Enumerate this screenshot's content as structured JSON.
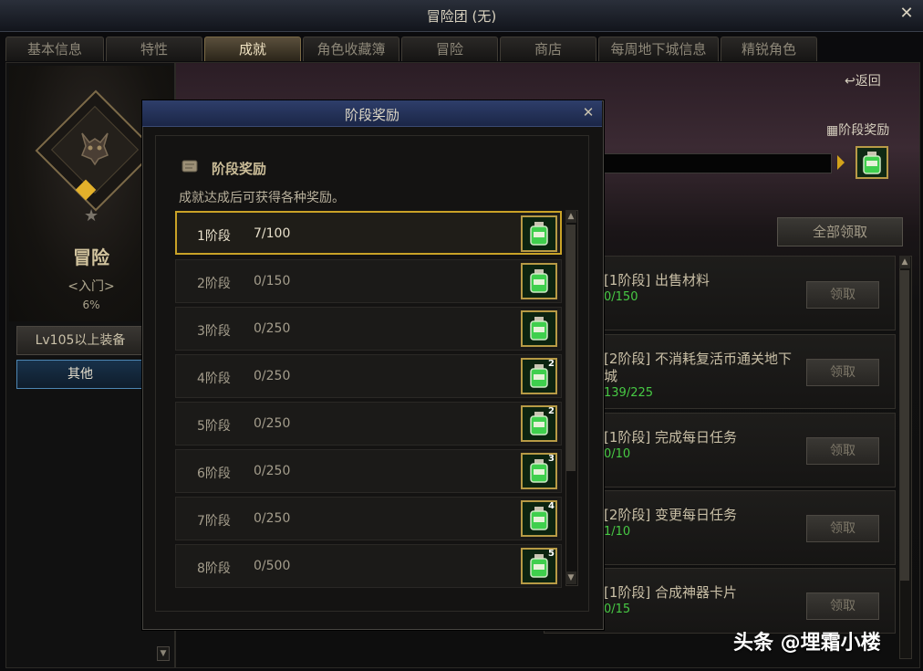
{
  "window": {
    "title": "冒险团 (无)",
    "close_label": "✕"
  },
  "tabs": [
    {
      "label": "基本信息",
      "active": false
    },
    {
      "label": "特性",
      "active": false
    },
    {
      "label": "成就",
      "active": true
    },
    {
      "label": "角色收藏簿",
      "active": false
    },
    {
      "label": "冒险",
      "active": false
    },
    {
      "label": "商店",
      "active": false
    },
    {
      "label": "每周地下城信息",
      "active": false
    },
    {
      "label": "精锐角色",
      "active": false
    }
  ],
  "left": {
    "rank_title": "冒险",
    "rank_sub": "<入门>",
    "rank_pct": "6%",
    "categories": [
      {
        "label": "Lv105以上装备",
        "selected": false
      },
      {
        "label": "其他",
        "selected": true
      }
    ]
  },
  "right": {
    "return_label": "返回",
    "stage_reward_label": "阶段奖励",
    "claim_all_label": "全部领取",
    "achievements": [
      {
        "name": "[1阶段] 出售材料",
        "progress": "0/150",
        "claim": "领取"
      },
      {
        "name": "[2阶段] 不消耗复活币通关地下城",
        "progress": "139/225",
        "claim": "领取"
      },
      {
        "name": "[1阶段] 完成每日任务",
        "progress": "0/10",
        "claim": "领取"
      },
      {
        "name": "[2阶段] 变更每日任务",
        "progress": "1/10",
        "claim": "领取"
      },
      {
        "name": "[1阶段] 合成神器卡片",
        "progress": "0/15",
        "claim": "领取"
      }
    ]
  },
  "modal": {
    "title": "阶段奖励",
    "close_label": "✕",
    "heading": "阶段奖励",
    "description": "成就达成后可获得各种奖励。",
    "stages": [
      {
        "label": "1阶段",
        "progress": "7/100",
        "badge": "",
        "selected": true
      },
      {
        "label": "2阶段",
        "progress": "0/150",
        "badge": "",
        "selected": false
      },
      {
        "label": "3阶段",
        "progress": "0/250",
        "badge": "",
        "selected": false
      },
      {
        "label": "4阶段",
        "progress": "0/250",
        "badge": "2",
        "selected": false
      },
      {
        "label": "5阶段",
        "progress": "0/250",
        "badge": "2",
        "selected": false
      },
      {
        "label": "6阶段",
        "progress": "0/250",
        "badge": "3",
        "selected": false
      },
      {
        "label": "7阶段",
        "progress": "0/250",
        "badge": "4",
        "selected": false
      },
      {
        "label": "8阶段",
        "progress": "0/500",
        "badge": "5",
        "selected": false
      }
    ]
  },
  "watermark": "头条 @埋霜小楼",
  "colors": {
    "gold": "#c9a227",
    "progress_green": "#47c944",
    "modal_title_blue": "#2e3e6a"
  },
  "icons": [
    "close-icon",
    "demon-emblem-icon",
    "star-icon",
    "return-icon",
    "gift-icon",
    "potion-icon",
    "scroll-icon"
  ]
}
